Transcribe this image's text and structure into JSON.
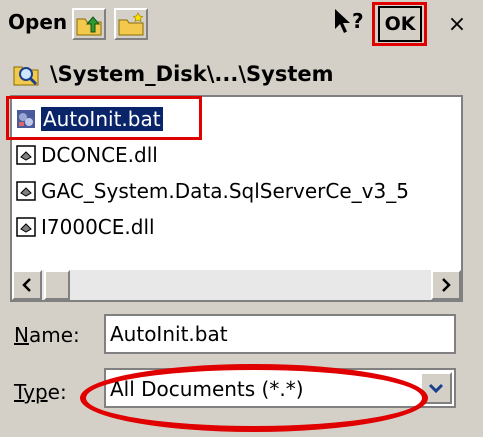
{
  "dialog": {
    "title": "Open",
    "ok_label": "OK",
    "close_label": "×",
    "path": "\\System_Disk\\...\\System"
  },
  "files": [
    {
      "name": "AutoInit.bat",
      "icon": "batch-file-icon",
      "selected": true
    },
    {
      "name": "DCONCE.dll",
      "icon": "dll-file-icon"
    },
    {
      "name": "GAC_System.Data.SqlServerCe_v3_5",
      "icon": "dll-file-icon"
    },
    {
      "name": "I7000CE.dll",
      "icon": "dll-file-icon"
    }
  ],
  "fields": {
    "name_label_prefix": "N",
    "name_label_rest": "ame:",
    "name_value": "AutoInit.bat",
    "type_label_prefix": "Typ",
    "type_label_rest": "e:",
    "type_value": "All Documents (*.*)"
  },
  "colors": {
    "highlight": "#e00000",
    "selection": "#0a246a"
  }
}
